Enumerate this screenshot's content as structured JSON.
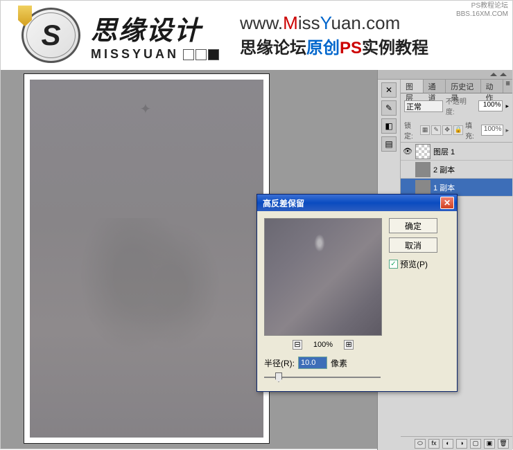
{
  "header": {
    "logo_cn": "思缘设计",
    "logo_en": "MISSYUAN",
    "url_prefix": "www.",
    "url_M": "M",
    "url_iss": "iss",
    "url_Y": "Y",
    "url_suffix": "uan.com",
    "tagline_a": "思缘论坛",
    "tagline_b": "原创",
    "tagline_c": "PS",
    "tagline_d": "实例教程"
  },
  "watermark": {
    "line1": "PS教程论坛",
    "line2": "BBS.16XM.COM"
  },
  "panels": {
    "tabs": [
      "图层",
      "通道",
      "历史记录",
      "动作"
    ],
    "blend_mode": "正常",
    "opacity_label": "不透明度:",
    "opacity_value": "100%",
    "lock_label": "锁定:",
    "fill_label": "填充:",
    "fill_value": "100%",
    "layers": [
      {
        "name": "图层 1",
        "selected": false
      },
      {
        "name": "2 副本",
        "selected": false
      },
      {
        "name": "1 副本",
        "selected": true
      }
    ]
  },
  "dialog": {
    "title": "高反差保留",
    "ok": "确定",
    "cancel": "取消",
    "preview_label": "预览(P)",
    "zoom_value": "100%",
    "radius_label": "半径(R):",
    "radius_value": "10.0",
    "radius_unit": "像素"
  }
}
